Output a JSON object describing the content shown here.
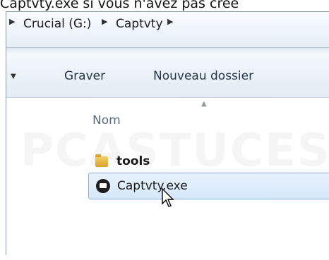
{
  "caption": "Captvty.exe si vous n'avez pas créé",
  "address": {
    "crumbs": [
      "Crucial (G:)",
      "Captvty"
    ]
  },
  "toolbar": {
    "burn_label": "Graver",
    "new_folder_label": "Nouveau dossier"
  },
  "columns": {
    "name_label": "Nom"
  },
  "files": [
    {
      "name": "tools",
      "icon": "folder-icon",
      "selected": false
    },
    {
      "name": "Captvty.exe",
      "icon": "application-icon",
      "selected": true
    }
  ],
  "watermark": "PCASTUCES",
  "colors": {
    "selection_bg": "#d6e8fb",
    "selection_border": "#84acdd",
    "toolbar_text": "#25364a"
  }
}
